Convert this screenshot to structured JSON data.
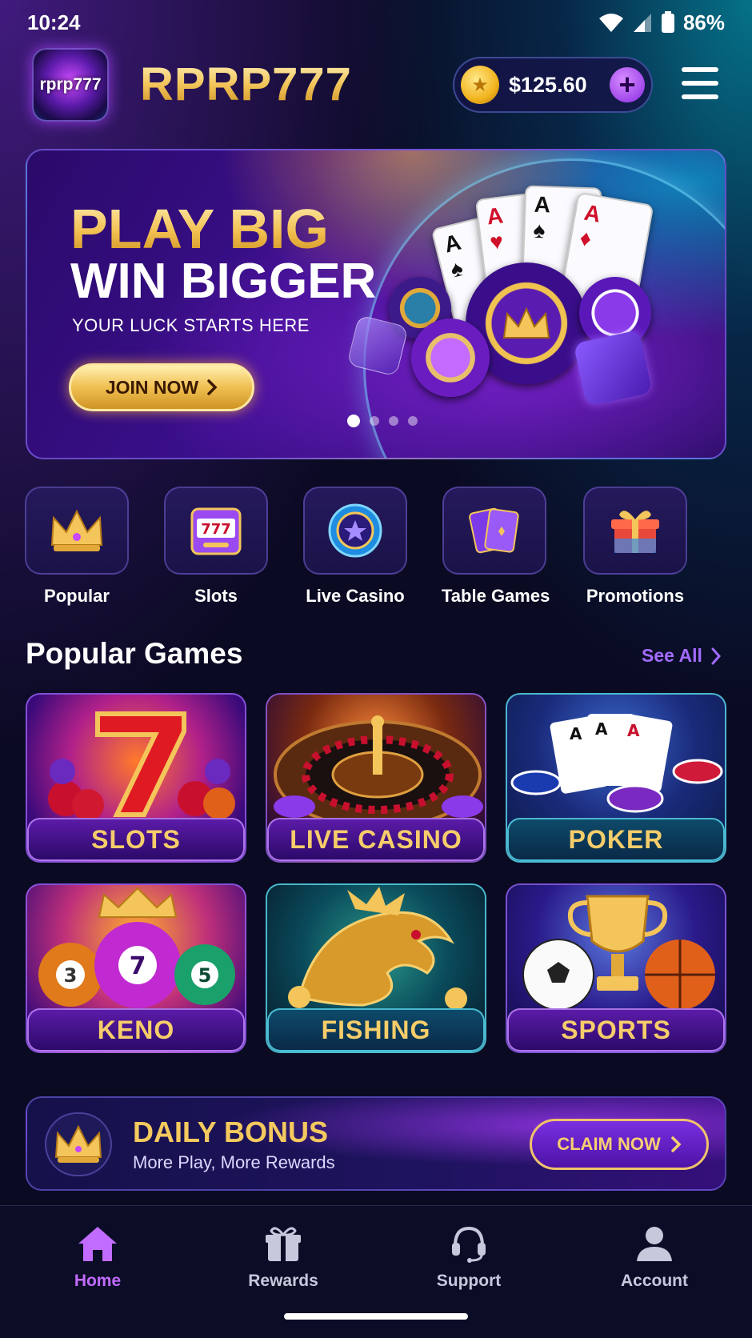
{
  "status": {
    "time": "10:24",
    "battery": "86%"
  },
  "header": {
    "logo_text": "rprp777",
    "title": "RPRP777",
    "balance": "$125.60"
  },
  "banner": {
    "title1": "PLAY BIG",
    "title2": "WIN BIGGER",
    "subtitle": "YOUR LUCK STARTS HERE",
    "cta": "JOIN NOW",
    "slides": 4,
    "active_slide": 1
  },
  "categories": [
    {
      "label": "Popular",
      "icon": "crown-icon"
    },
    {
      "label": "Slots",
      "icon": "slot-machine-icon"
    },
    {
      "label": "Live Casino",
      "icon": "casino-chip-icon"
    },
    {
      "label": "Table Games",
      "icon": "playing-cards-icon"
    },
    {
      "label": "Promotions",
      "icon": "gift-box-icon"
    }
  ],
  "popular": {
    "title": "Popular Games",
    "see_all": "See All",
    "games": [
      {
        "label": "SLOTS"
      },
      {
        "label": "LIVE CASINO"
      },
      {
        "label": "POKER"
      },
      {
        "label": "KENO"
      },
      {
        "label": "FISHING"
      },
      {
        "label": "SPORTS"
      }
    ]
  },
  "bonus": {
    "title": "DAILY BONUS",
    "subtitle": "More Play, More Rewards",
    "cta": "CLAIM NOW"
  },
  "nav": [
    {
      "label": "Home",
      "active": true
    },
    {
      "label": "Rewards",
      "active": false
    },
    {
      "label": "Support",
      "active": false
    },
    {
      "label": "Account",
      "active": false
    }
  ],
  "colors": {
    "gold": "#f3c55a",
    "purple": "#8a2be2",
    "accent": "#a26bff",
    "background": "#0a0a22"
  }
}
